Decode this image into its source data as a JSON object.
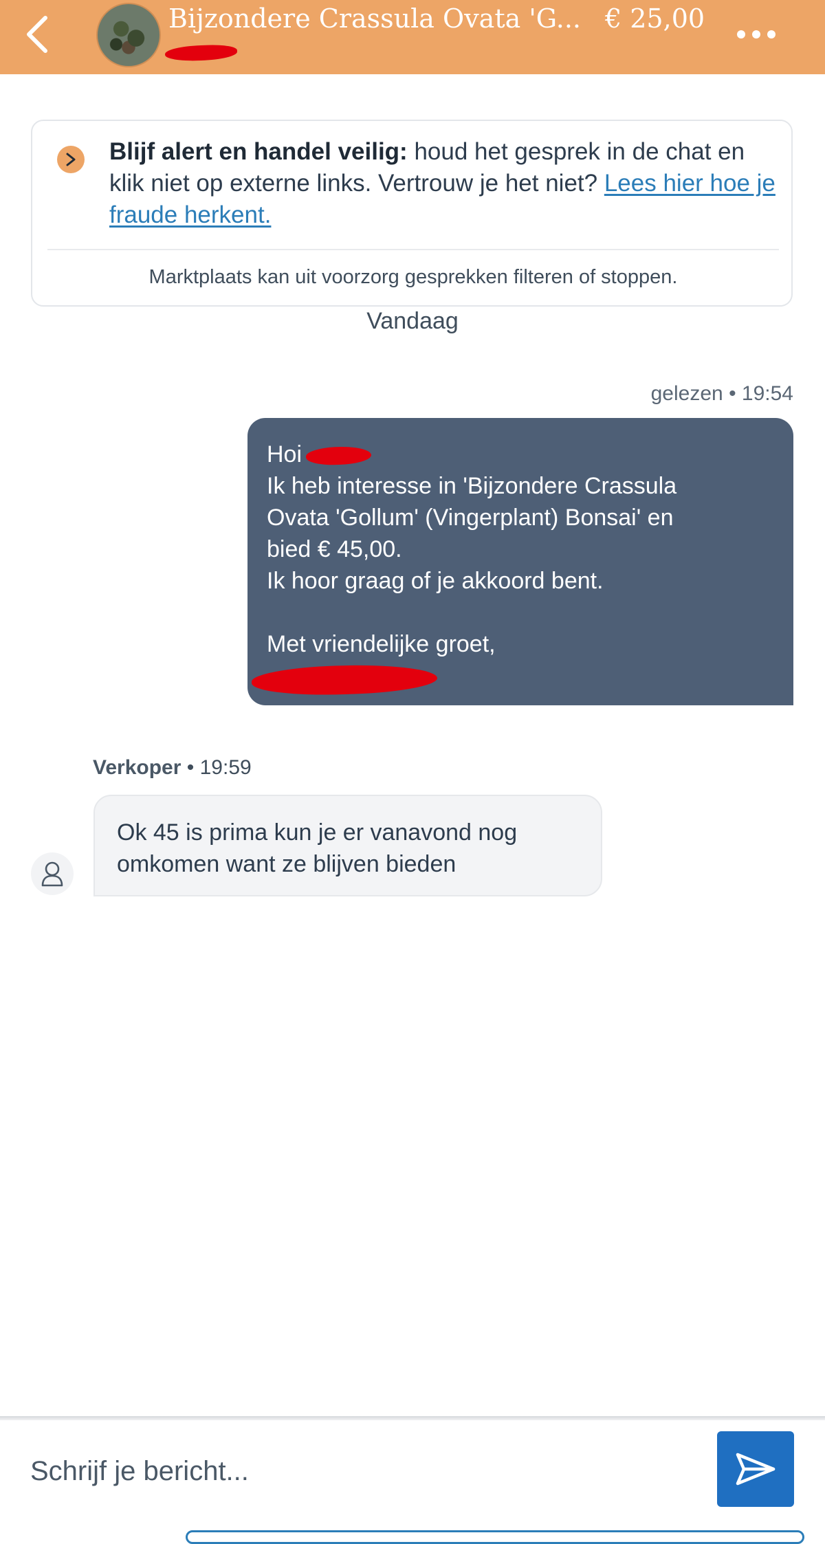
{
  "header": {
    "title": "Bijzondere Crassula Ovata 'G...",
    "price": "€ 25,00",
    "back_icon": "chevron-left-icon",
    "more_icon": "more-dots-icon",
    "background_color": "#eda566"
  },
  "safety_notice": {
    "bold": "Blijf alert en handel veilig:",
    "text": " houd het gesprek in de chat en klik niet op externe links. Vertrouw je het niet? ",
    "link": "Lees hier hoe je fraude herkent.",
    "footer": "Marktplaats kan uit voorzorg gesprekken filteren of stoppen.",
    "icon": "chevron-right-icon"
  },
  "date_separator": "Vandaag",
  "outgoing_message": {
    "status": "gelezen",
    "separator": "•",
    "time": "19:54",
    "greeting": "Hoi",
    "lines": [
      "Ik heb interesse in 'Bijzondere Crassula",
      "Ovata 'Gollum' (Vingerplant) Bonsai' en",
      "bied € 45,00.",
      "Ik hoor graag of je akkoord bent."
    ],
    "closing": "Met vriendelijke groet,",
    "bubble_color": "#4e5f76"
  },
  "incoming_message": {
    "sender": "Verkoper",
    "separator": "•",
    "time": "19:59",
    "lines": [
      "Ok 45 is prima kun je er vanavond nog",
      "omkomen want ze blijven bieden"
    ],
    "avatar_icon": "user-icon"
  },
  "composer": {
    "placeholder": "Schrijf je bericht...",
    "send_icon": "send-icon",
    "send_color": "#1f6fc1"
  }
}
